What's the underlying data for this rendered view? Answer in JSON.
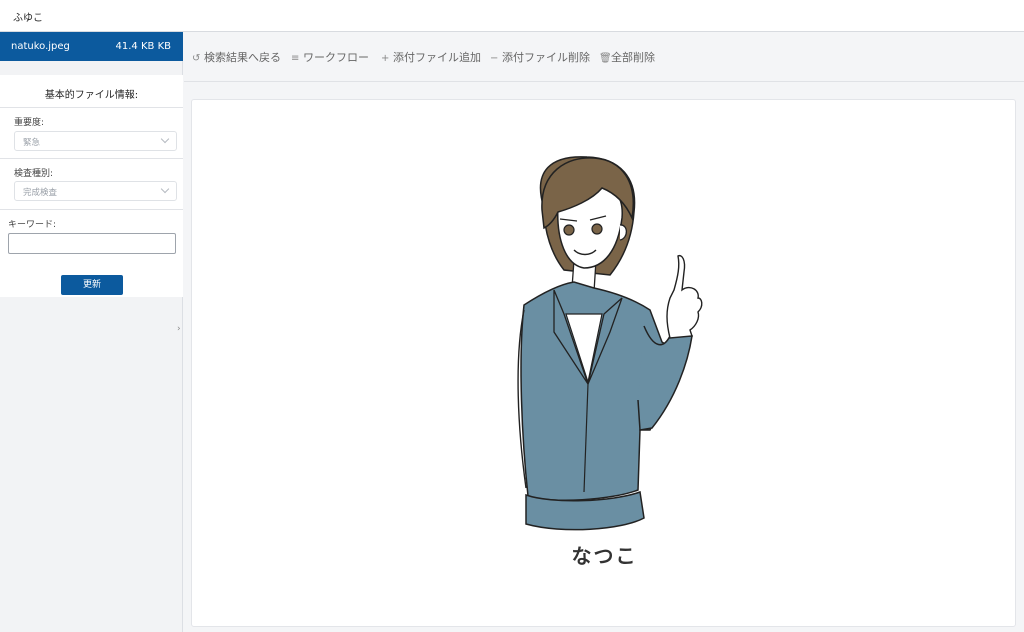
{
  "app": {
    "title": "ふゆこ"
  },
  "file": {
    "name": "natuko.jpeg",
    "size": "41.4 KB KB"
  },
  "sidebar": {
    "panel_title": "基本的ファイル情報:",
    "importance": {
      "label": "重要度:",
      "value": "緊急"
    },
    "inspection": {
      "label": "検査種別:",
      "value": "完成検査"
    },
    "keyword": {
      "label": "キーワード:",
      "value": ""
    },
    "update_label": "更新",
    "collapse_glyph": "›"
  },
  "toolbar": {
    "back": "検索結果へ戻る",
    "workflow": "ワークフロー",
    "add_attachment": "添付ファイル追加",
    "remove_attachment": "添付ファイル削除",
    "delete_all": "全部削除"
  },
  "viewer": {
    "caption": "なつこ"
  },
  "colors": {
    "accent": "#0c5a9e",
    "suit": "#6a8fa3",
    "hair": "#7a6448"
  }
}
